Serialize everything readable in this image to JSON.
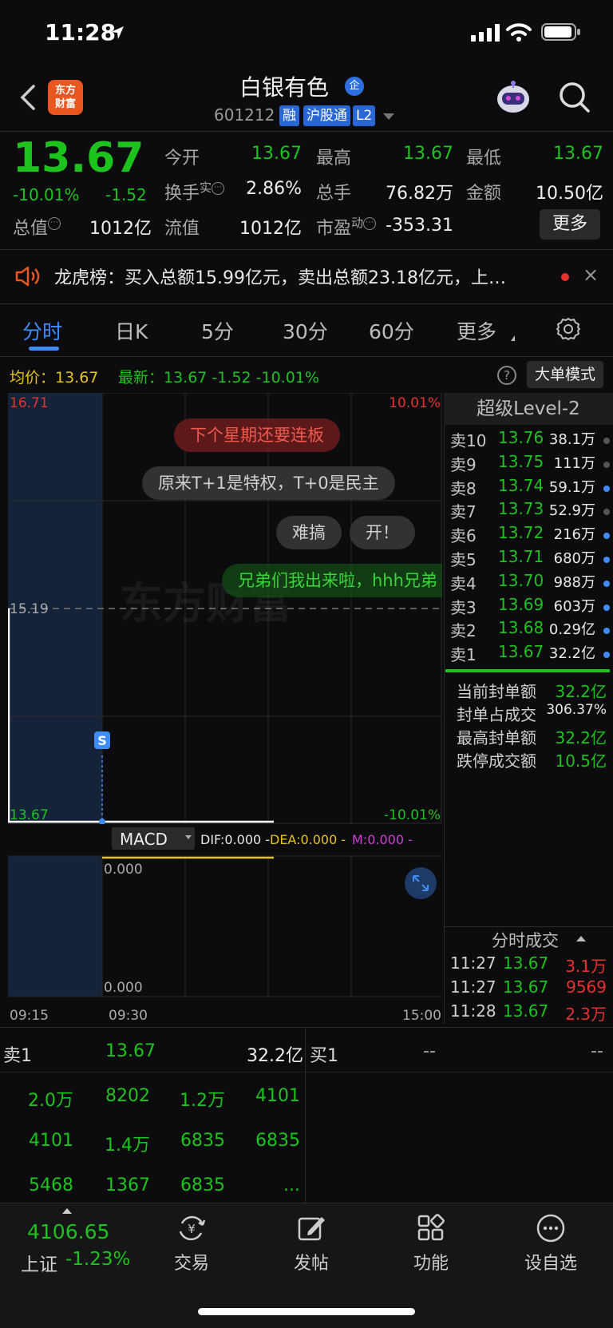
{
  "status_bar": {
    "time": "11:28"
  },
  "header": {
    "stock_name": "白银有色",
    "ent_badge": "企",
    "stock_code": "601212",
    "tags": [
      "融",
      "沪股通",
      "L2"
    ],
    "logo_text_1": "东方",
    "logo_text_2": "财富"
  },
  "quote": {
    "price": "13.67",
    "pct_change": "-10.01%",
    "abs_change": "-1.52",
    "open_label": "今开",
    "open": "13.67",
    "high_label": "最高",
    "high": "13.67",
    "low_label": "最低",
    "low": "13.67",
    "turnover_label": "换手",
    "turnover_sup": "实",
    "turnover": "2.86%",
    "volume_label": "总手",
    "volume": "76.82万",
    "amount_label": "金额",
    "amount": "10.50亿",
    "mktcap_label": "总值",
    "mktcap": "1012亿",
    "float_label": "流值",
    "float_cap": "1012亿",
    "pe_label": "市盈",
    "pe_sup": "动",
    "pe": "-353.31",
    "more_button": "更多"
  },
  "notice": {
    "text": "龙虎榜：买入总额15.99亿元，卖出总额23.18亿元，上…",
    "close": "×"
  },
  "tabs": [
    "分时",
    "日K",
    "5分",
    "30分",
    "60分",
    "更多"
  ],
  "chart_info": {
    "avg_text": "均价：13.67",
    "latest_text": "最新：13.67  -1.52  -10.01%",
    "big_order_button": "大单模式",
    "help": "?"
  },
  "chart": {
    "y_top": "16.71",
    "y_mid": "15.19",
    "y_bottom": "13.67",
    "pct_top": "10.01%",
    "pct_bottom": "-10.01%",
    "marker": "S",
    "watermark": "东方财富",
    "macd_selector": "MACD",
    "dif": "DIF:0.000 -",
    "dea": "DEA:0.000 -",
    "m": "M:0.000 -",
    "macd_top": "0.000",
    "macd_bottom": "0.000",
    "time_start": "09:15",
    "time_open": "09:30",
    "time_end": "15:00",
    "colors": {
      "up": "#e5322d",
      "down": "#1dc31d",
      "avg": "#e6c21c",
      "accent": "#3f8cf5"
    }
  },
  "danmaku": [
    "下个星期还要连板",
    "原来T+1是特权，T+0是民主",
    "难搞",
    "开！",
    "兄弟们我出来啦，hhh兄弟"
  ],
  "level2": {
    "title": "超级Level-2",
    "asks": [
      {
        "label": "卖10",
        "price": "13.76",
        "vol": "38.1万",
        "dot": "gray"
      },
      {
        "label": "卖9",
        "price": "13.75",
        "vol": "111万",
        "dot": "gray"
      },
      {
        "label": "卖8",
        "price": "13.74",
        "vol": "59.1万",
        "dot": "blue"
      },
      {
        "label": "卖7",
        "price": "13.73",
        "vol": "52.9万",
        "dot": "gray"
      },
      {
        "label": "卖6",
        "price": "13.72",
        "vol": "216万",
        "dot": "blue"
      },
      {
        "label": "卖5",
        "price": "13.71",
        "vol": "680万",
        "dot": "blue"
      },
      {
        "label": "卖4",
        "price": "13.70",
        "vol": "988万",
        "dot": "blue"
      },
      {
        "label": "卖3",
        "price": "13.69",
        "vol": "603万",
        "dot": "blue"
      },
      {
        "label": "卖2",
        "price": "13.68",
        "vol": "0.29亿",
        "dot": "blue"
      },
      {
        "label": "卖1",
        "price": "13.67",
        "vol": "32.2亿",
        "dot": "blue"
      }
    ],
    "seal": [
      {
        "label": "当前封单额",
        "value": "32.2亿"
      },
      {
        "label": "封单占成交",
        "value": "306.37%"
      },
      {
        "label": "最高封单额",
        "value": "32.2亿"
      },
      {
        "label": "跌停成交额",
        "value": "10.5亿"
      }
    ],
    "trades_title": "分时成交",
    "trades": [
      {
        "time": "11:27",
        "price": "13.67",
        "vol": "3.1万"
      },
      {
        "time": "11:27",
        "price": "13.67",
        "vol": "9569"
      },
      {
        "time": "11:28",
        "price": "13.67",
        "vol": "2.3万"
      }
    ]
  },
  "book": {
    "sell1_label": "卖1",
    "sell1_price": "13.67",
    "sell1_vol": "32.2亿",
    "buy1_label": "买1",
    "buy1_price": "--",
    "buy1_vol": "--",
    "queue": [
      [
        "2.0万",
        "8202",
        "1.2万",
        "4101"
      ],
      [
        "4101",
        "1.4万",
        "6835",
        "6835"
      ],
      [
        "5468",
        "1367",
        "6835",
        "..."
      ]
    ]
  },
  "tabbar": {
    "index_value": "4106.65",
    "index_name": "上证",
    "index_pct": "-1.23%",
    "items": [
      "交易",
      "发帖",
      "功能",
      "设自选"
    ]
  }
}
